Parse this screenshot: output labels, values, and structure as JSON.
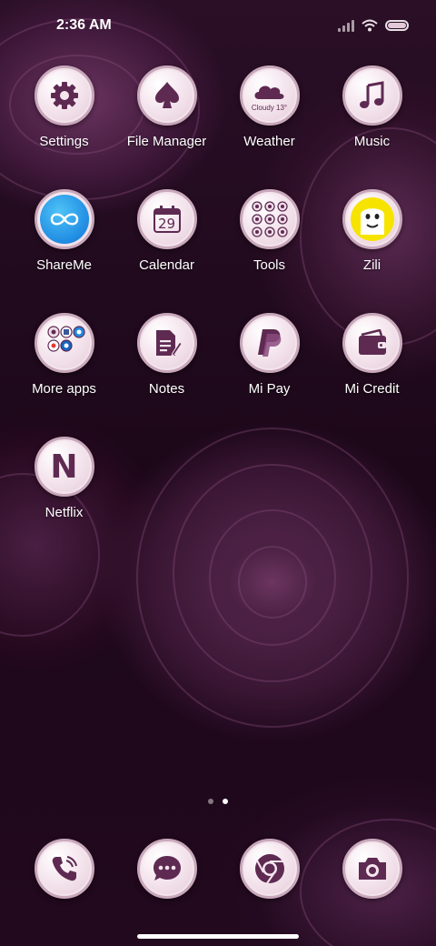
{
  "status_bar": {
    "time": "2:36 AM"
  },
  "apps": [
    {
      "label": "Settings",
      "icon": "gear-icon"
    },
    {
      "label": "File Manager",
      "icon": "spade-icon"
    },
    {
      "label": "Weather",
      "icon": "cloud-icon",
      "icon_text": "Cloudy 13°"
    },
    {
      "label": "Music",
      "icon": "music-note-icon"
    },
    {
      "label": "ShareMe",
      "icon": "infinity-icon"
    },
    {
      "label": "Calendar",
      "icon": "calendar-icon",
      "icon_text": "29"
    },
    {
      "label": "Tools",
      "icon": "tools-folder-icon"
    },
    {
      "label": "Zili",
      "icon": "smiley-face-icon"
    },
    {
      "label": "More apps",
      "icon": "apps-folder-icon"
    },
    {
      "label": "Notes",
      "icon": "notes-icon"
    },
    {
      "label": "Mi Pay",
      "icon": "paypal-icon"
    },
    {
      "label": "Mi Credit",
      "icon": "wallet-icon"
    },
    {
      "label": "Netflix",
      "icon": "netflix-icon",
      "icon_text": "N"
    }
  ],
  "dock": [
    {
      "name": "phone",
      "icon": "phone-icon"
    },
    {
      "name": "messages",
      "icon": "message-icon"
    },
    {
      "name": "browser",
      "icon": "chrome-icon"
    },
    {
      "name": "camera",
      "icon": "camera-icon"
    }
  ],
  "page_indicator": {
    "pages": 2,
    "current": 2
  },
  "colors": {
    "icon_glyph": "#5e2a52",
    "icon_face": "#f5e6ee",
    "label_text": "#ffffff"
  }
}
